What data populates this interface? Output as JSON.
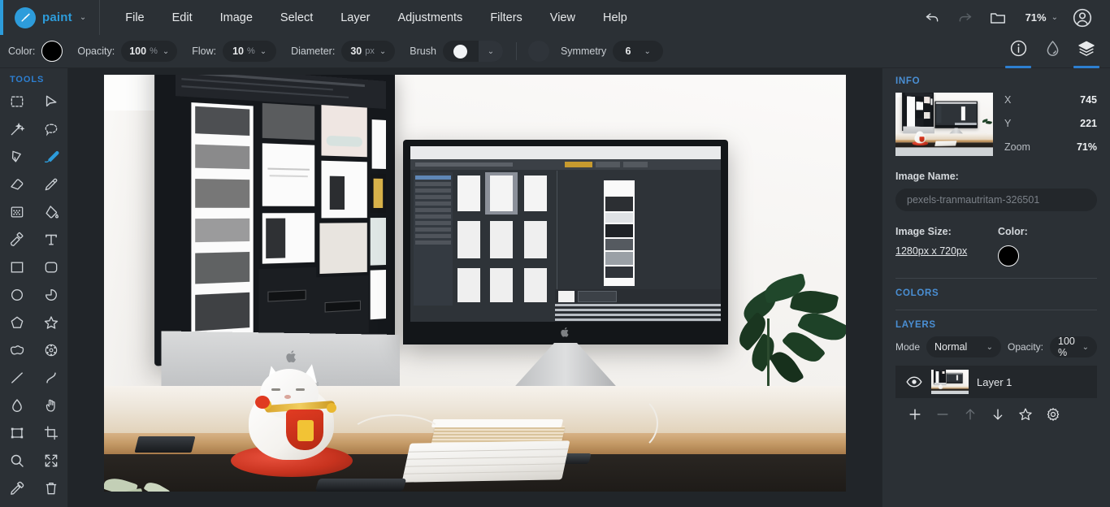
{
  "app": {
    "brand": "paint",
    "brand_color": "#2d9cdb",
    "brand_caret": "⌄",
    "logo_icon": "paint-brush-icon"
  },
  "menubar": {
    "items": [
      {
        "label": "File",
        "name": "menu-file"
      },
      {
        "label": "Edit",
        "name": "menu-edit"
      },
      {
        "label": "Image",
        "name": "menu-image"
      },
      {
        "label": "Select",
        "name": "menu-select"
      },
      {
        "label": "Layer",
        "name": "menu-layer"
      },
      {
        "label": "Adjustments",
        "name": "menu-adjustments"
      },
      {
        "label": "Filters",
        "name": "menu-filters"
      },
      {
        "label": "View",
        "name": "menu-view"
      },
      {
        "label": "Help",
        "name": "menu-help"
      }
    ],
    "undo_icon": "undo-arrow-icon",
    "redo_icon": "redo-arrow-icon",
    "open_icon": "folder-open-icon",
    "zoom_value": "71%",
    "zoom_caret": "⌄",
    "account_icon": "user-account-icon"
  },
  "options": {
    "color_label": "Color:",
    "color_value": "#000000",
    "opacity_label": "Opacity:",
    "opacity_value": "100",
    "opacity_unit": "%",
    "flow_label": "Flow:",
    "flow_value": "10",
    "flow_unit": "%",
    "diameter_label": "Diameter:",
    "diameter_value": "30",
    "diameter_unit": "px",
    "brush_label": "Brush",
    "brush_preview": "soft-round-brush",
    "secondary_color_value": "#2f343a",
    "symmetry_label": "Symmetry",
    "symmetry_value": "6",
    "caret": "⌄",
    "panel_tabs": [
      {
        "name": "tab-info",
        "icon": "info-circle-icon",
        "active": true
      },
      {
        "name": "tab-colors",
        "icon": "water-drop-icon",
        "active": false
      },
      {
        "name": "tab-layers",
        "icon": "layers-stack-icon",
        "active": true
      }
    ],
    "active_underline_color": "#2d7fd1"
  },
  "tools": {
    "title": "TOOLS",
    "active_tool": "paintbrush",
    "items": [
      {
        "name": "tool-rectangle-select",
        "icon": "marquee-select-icon"
      },
      {
        "name": "tool-move",
        "icon": "cursor-arrow-icon"
      },
      {
        "name": "tool-magic-wand",
        "icon": "magic-wand-icon"
      },
      {
        "name": "tool-lasso-select",
        "icon": "lasso-select-icon"
      },
      {
        "name": "tool-pen",
        "icon": "pen-nib-icon"
      },
      {
        "name": "tool-paintbrush",
        "icon": "paintbrush-icon"
      },
      {
        "name": "tool-eraser",
        "icon": "eraser-icon"
      },
      {
        "name": "tool-pencil",
        "icon": "pencil-icon"
      },
      {
        "name": "tool-pattern",
        "icon": "checker-pattern-icon"
      },
      {
        "name": "tool-paint-bucket",
        "icon": "paint-bucket-icon"
      },
      {
        "name": "tool-clone-stamp",
        "icon": "clone-stamp-icon"
      },
      {
        "name": "tool-text",
        "icon": "text-tool-icon"
      },
      {
        "name": "tool-rectangle",
        "icon": "square-shape-icon"
      },
      {
        "name": "tool-rounded-rectangle",
        "icon": "rounded-square-icon"
      },
      {
        "name": "tool-ellipse",
        "icon": "circle-shape-icon"
      },
      {
        "name": "tool-pie",
        "icon": "pie-shape-icon"
      },
      {
        "name": "tool-polygon",
        "icon": "pentagon-shape-icon"
      },
      {
        "name": "tool-star",
        "icon": "star-shape-icon"
      },
      {
        "name": "tool-blob",
        "icon": "blob-shape-icon"
      },
      {
        "name": "tool-flower",
        "icon": "flower-shape-icon"
      },
      {
        "name": "tool-line",
        "icon": "line-icon"
      },
      {
        "name": "tool-curve",
        "icon": "curve-icon"
      },
      {
        "name": "tool-blur",
        "icon": "water-drop-icon"
      },
      {
        "name": "tool-hand",
        "icon": "hand-pan-icon"
      },
      {
        "name": "tool-transform",
        "icon": "transform-box-icon"
      },
      {
        "name": "tool-crop",
        "icon": "crop-icon"
      },
      {
        "name": "tool-zoom",
        "icon": "magnifier-icon"
      },
      {
        "name": "tool-fullscreen",
        "icon": "expand-arrows-icon"
      },
      {
        "name": "tool-color-picker",
        "icon": "eyedropper-icon"
      },
      {
        "name": "tool-delete",
        "icon": "trash-can-icon"
      }
    ]
  },
  "info": {
    "title": "INFO",
    "rows": [
      {
        "key": "X",
        "value": "745"
      },
      {
        "key": "Y",
        "value": "221"
      },
      {
        "key": "Zoom",
        "value": "71%"
      }
    ],
    "image_name_label": "Image Name:",
    "image_name_value": "pexels-tranmautritam-326501",
    "image_size_label": "Image Size:",
    "image_size_value": "1280px x 720px",
    "color_label": "Color:",
    "color_value": "#000000"
  },
  "colors": {
    "title": "COLORS"
  },
  "layers": {
    "title": "LAYERS",
    "mode_label": "Mode",
    "mode_value": "Normal",
    "opacity_label": "Opacity:",
    "opacity_value": "100 %",
    "caret": "⌄",
    "items": [
      {
        "name": "layer-row-1",
        "label": "Layer 1",
        "visible": true,
        "visibility_icon": "eye-icon"
      }
    ],
    "actions": [
      {
        "name": "add-layer-button",
        "icon": "plus-icon",
        "enabled": true
      },
      {
        "name": "remove-layer-button",
        "icon": "minus-icon",
        "enabled": false
      },
      {
        "name": "move-layer-up-button",
        "icon": "arrow-up-icon",
        "enabled": false
      },
      {
        "name": "move-layer-down-button",
        "icon": "arrow-down-icon",
        "enabled": true
      },
      {
        "name": "favorite-layer-button",
        "icon": "star-icon",
        "enabled": true
      },
      {
        "name": "layer-settings-button",
        "icon": "gear-icon",
        "enabled": true
      }
    ]
  },
  "canvas": {
    "image_alt": "photo of a desk with two apple monitors, a maneki-neko cat figurine, keyboard, notebooks and a potted plant"
  }
}
